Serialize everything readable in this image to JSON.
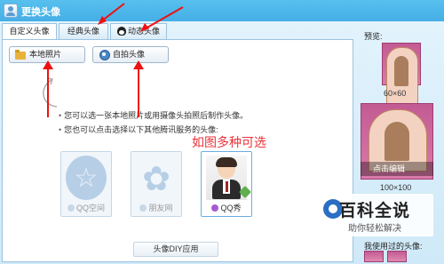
{
  "window": {
    "title": "更换头像"
  },
  "tabs": [
    {
      "label": "自定义头像",
      "active": true
    },
    {
      "label": "经典头像",
      "active": false
    },
    {
      "label": "动态头像",
      "active": false
    }
  ],
  "buttons": {
    "local_photo": "本地照片",
    "selfie": "自拍头像"
  },
  "tips": [
    "您可以选一张本地照片或用摄像头拍照后制作头像。",
    "您也可以点击选择以下其他腾讯服务的头像:"
  ],
  "annotation": "如图多种可选",
  "services": [
    {
      "label": "QQ空间"
    },
    {
      "label": "朋友网"
    },
    {
      "label": "QQ秀"
    }
  ],
  "diy_label": "头像DIY应用",
  "sidebar": {
    "preview_label": "预览:",
    "size_small": "60×60",
    "click_edit": "点击编辑",
    "size_large": "100×100",
    "used_label": "我使用过的头像:"
  },
  "watermark": {
    "title": "百科全说",
    "subtitle": "助你轻松解决"
  },
  "colors": {
    "titlebar": "#45aee6",
    "panel_bg": "#ffffff",
    "annotation": "#e8333a",
    "arrow": "#ee1111"
  }
}
